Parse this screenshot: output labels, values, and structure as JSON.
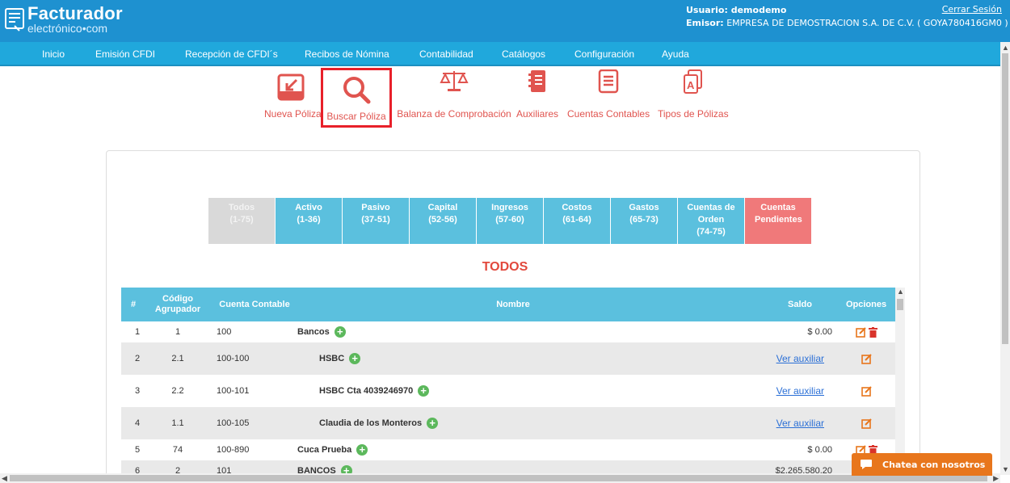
{
  "header": {
    "logo_main": "Facturador",
    "logo_sub": "electrónico•com",
    "user_label": "Usuario: demodemo",
    "emisor_label": "Emisor:",
    "emisor_value": "EMPRESA DE DEMOSTRACION S.A. DE C.V. ( GOYA780416GM0 )",
    "logout": "Cerrar Sesión"
  },
  "nav": {
    "items": [
      "Inicio",
      "Emisión CFDI",
      "Recepción de CFDI´s",
      "Recibos de Nómina",
      "Contabilidad",
      "Catálogos",
      "Configuración",
      "Ayuda"
    ]
  },
  "toolbar": {
    "items": [
      {
        "label": "Nueva Póliza",
        "icon": "new-policy-icon"
      },
      {
        "label": "Buscar Póliza",
        "icon": "search-icon"
      },
      {
        "label": "Balanza de Comprobación",
        "icon": "scale-icon"
      },
      {
        "label": "Auxiliares",
        "icon": "ledger-icon"
      },
      {
        "label": "Cuentas Contables",
        "icon": "list-icon"
      },
      {
        "label": "Tipos de Pólizas",
        "icon": "document-types-icon"
      }
    ],
    "active": "Buscar Póliza"
  },
  "filters": [
    {
      "name": "Todos",
      "range": "(1-75)"
    },
    {
      "name": "Activo",
      "range": "(1-36)"
    },
    {
      "name": "Pasivo",
      "range": "(37-51)"
    },
    {
      "name": "Capital",
      "range": "(52-56)"
    },
    {
      "name": "Ingresos",
      "range": "(57-60)"
    },
    {
      "name": "Costos",
      "range": "(61-64)"
    },
    {
      "name": "Gastos",
      "range": "(65-73)"
    },
    {
      "name": "Cuentas de Orden",
      "range": "(74-75)"
    },
    {
      "name": "Cuentas Pendientes",
      "range": ""
    }
  ],
  "section_title": "TODOS",
  "table": {
    "headers": {
      "num": "#",
      "codigo": "Código Agrupador",
      "cuenta": "Cuenta Contable",
      "nombre": "Nombre",
      "saldo": "Saldo",
      "opciones": "Opciones"
    },
    "rows": [
      {
        "num": "1",
        "codigo": "1",
        "cuenta": "100",
        "nombre": "Bancos",
        "saldo": "$ 0.00",
        "sub": false
      },
      {
        "num": "2",
        "codigo": "2.1",
        "cuenta": "100-100",
        "nombre": "HSBC",
        "saldo": "Ver auxiliar",
        "sub": true
      },
      {
        "num": "3",
        "codigo": "2.2",
        "cuenta": "100-101",
        "nombre": "HSBC Cta 4039246970",
        "saldo": "Ver auxiliar",
        "sub": true
      },
      {
        "num": "4",
        "codigo": "1.1",
        "cuenta": "100-105",
        "nombre": "Claudia de los Monteros",
        "saldo": "Ver auxiliar",
        "sub": true
      },
      {
        "num": "5",
        "codigo": "74",
        "cuenta": "100-890",
        "nombre": "Cuca Prueba",
        "saldo": "$ 0.00",
        "sub": false
      },
      {
        "num": "6",
        "codigo": "2",
        "cuenta": "101",
        "nombre": "BANCOS",
        "saldo": "$2,265,580.20",
        "sub": false
      }
    ]
  },
  "chat": {
    "label": "Chatea con nosotros"
  },
  "colors": {
    "header": "#1e91d0",
    "nav": "#20a8dc",
    "accent_red": "#e0544f",
    "table_header": "#5bc0de",
    "pending": "#f0797a",
    "chat": "#e8761c"
  }
}
